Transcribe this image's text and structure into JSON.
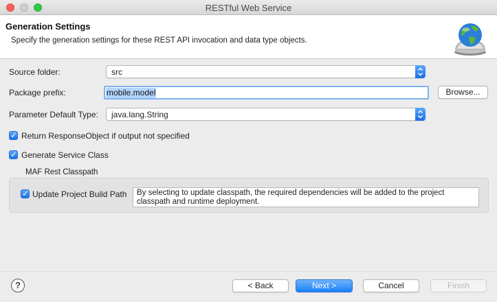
{
  "window": {
    "title": "RESTful Web Service"
  },
  "banner": {
    "title": "Generation Settings",
    "description": "Specify the generation settings for these REST API invocation and data type objects."
  },
  "form": {
    "source_folder": {
      "label": "Source folder:",
      "value": "src"
    },
    "package_prefix": {
      "label": "Package prefix:",
      "value": "mobile.model",
      "browse_label": "Browse..."
    },
    "parameter_default_type": {
      "label": "Parameter Default Type:",
      "value": "java.lang.String"
    },
    "return_response_object": {
      "label": "Return ResponseObject if output not specified",
      "checked": true
    },
    "generate_service_class": {
      "label": "Generate Service Class",
      "checked": true
    }
  },
  "maf_rest_classpath": {
    "title": "MAF Rest Classpath",
    "update_build_path": {
      "label": "Update Project Build Path",
      "checked": true
    },
    "note": "By selecting to update classpath, the required dependencies will be added to the project classpath and runtime deployment."
  },
  "footer": {
    "help_symbol": "?",
    "back_label": "< Back",
    "next_label": "Next >",
    "cancel_label": "Cancel",
    "finish_label": "Finish"
  },
  "icons": {
    "banner": "globe-bell-icon",
    "checkbox_mark": "✓",
    "combo_arrows": "up-down-chevron-icon"
  },
  "colors": {
    "accent": "#1a82fb",
    "selection": "#b3d4fd",
    "focus_ring": "#7eb3f2"
  }
}
